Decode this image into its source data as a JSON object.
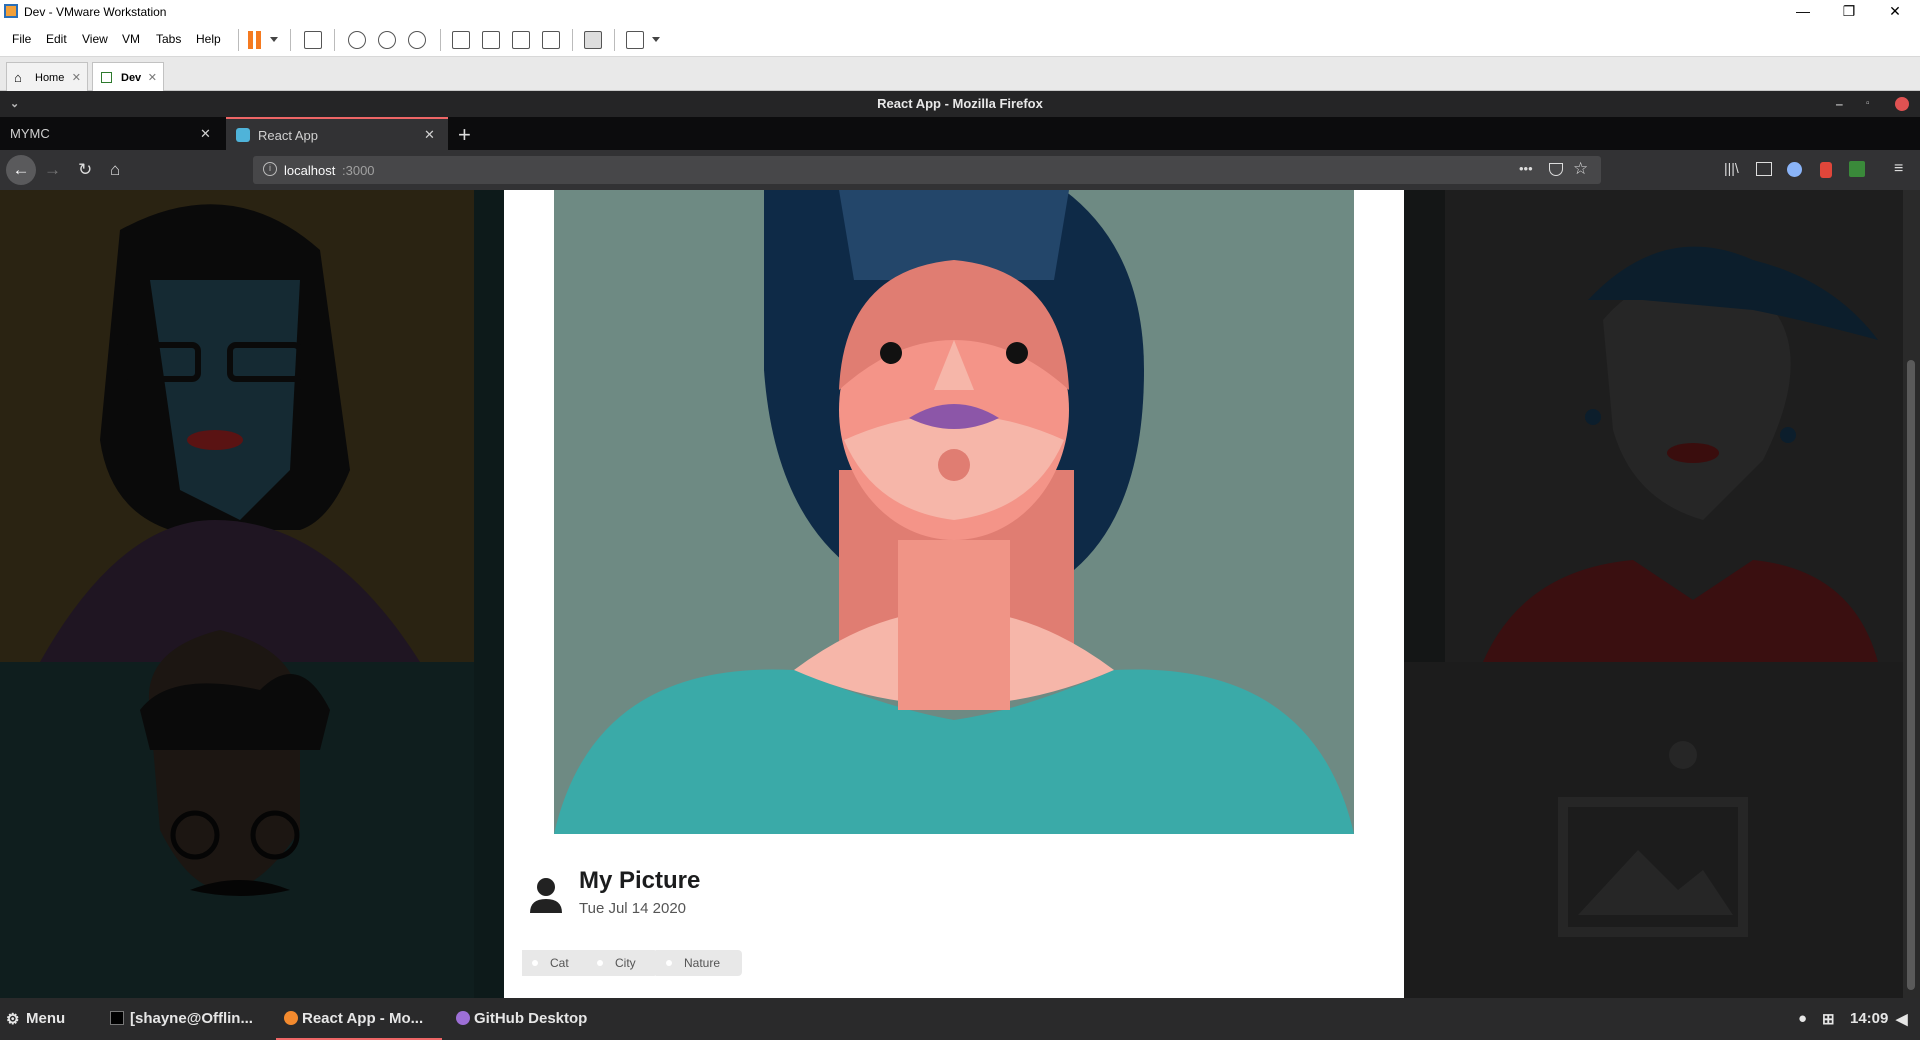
{
  "vmware": {
    "title": "Dev - VMware Workstation",
    "window_controls": {
      "minimize": "—",
      "restore": "❐",
      "close": "✕"
    },
    "menu": [
      "File",
      "Edit",
      "View",
      "VM",
      "Tabs",
      "Help"
    ],
    "tabs": [
      {
        "label": "Home",
        "active": false
      },
      {
        "label": "Dev",
        "active": true
      }
    ],
    "tab_close": "✕"
  },
  "firefox": {
    "title": "React App - Mozilla Firefox",
    "tabs": [
      {
        "label": "MYMC",
        "active": false
      },
      {
        "label": "React App",
        "active": true
      }
    ],
    "tab_close": "✕",
    "new_tab": "+",
    "url_host": "localhost",
    "url_port": ":3000",
    "more_actions": "•••"
  },
  "card": {
    "title": "My Picture",
    "date": "Tue Jul 14 2020",
    "tags": [
      "Cat",
      "City",
      "Nature"
    ]
  },
  "taskbar": {
    "menu_label": "Menu",
    "items": [
      "[shayne@Offlin...",
      "React App - Mo...",
      "GitHub Desktop"
    ],
    "time": "14:09"
  },
  "colors": {
    "portrait_bg": "#6e8a83",
    "accent_tab": "#e66666",
    "card_bg": "#ffffff"
  },
  "icons": [
    "vmware-logo-icon",
    "pause-icon",
    "dropdown-icon",
    "send-keys-icon",
    "snapshot-icon",
    "revert-icon",
    "manage-snapshots-icon",
    "library-icon",
    "console-icon",
    "fullscreen-icon",
    "back-icon",
    "forward-icon",
    "reload-icon",
    "home-icon",
    "info-icon",
    "pocket-icon",
    "bookmark-star-icon",
    "library-icon",
    "sidebar-icon",
    "menu-icon",
    "user-avatar-icon",
    "gear-icon",
    "terminal-icon",
    "firefox-icon",
    "github-icon",
    "network-icon",
    "volume-icon"
  ]
}
